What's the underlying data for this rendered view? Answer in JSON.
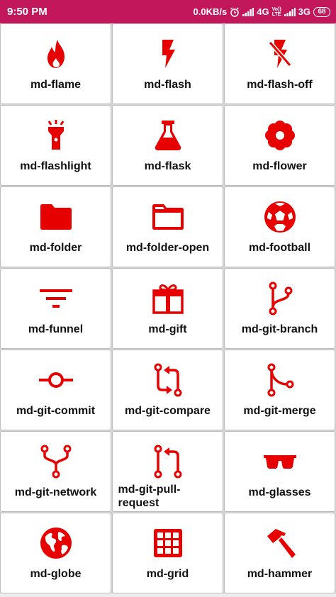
{
  "status_bar": {
    "time": "9:50 PM",
    "net_speed": "0.0KB/s",
    "network1": "4G",
    "volte_top": "Vo))",
    "volte_bottom": "LTE",
    "network2": "3G",
    "battery": "68"
  },
  "icon_color": "#e60000",
  "status_color": "#c2185b",
  "icons": [
    {
      "label": "md-flame",
      "icon": "flame-icon"
    },
    {
      "label": "md-flash",
      "icon": "flash-icon"
    },
    {
      "label": "md-flash-off",
      "icon": "flash-off-icon"
    },
    {
      "label": "md-flashlight",
      "icon": "flashlight-icon"
    },
    {
      "label": "md-flask",
      "icon": "flask-icon"
    },
    {
      "label": "md-flower",
      "icon": "flower-icon"
    },
    {
      "label": "md-folder",
      "icon": "folder-icon"
    },
    {
      "label": "md-folder-open",
      "icon": "folder-open-icon"
    },
    {
      "label": "md-football",
      "icon": "football-icon"
    },
    {
      "label": "md-funnel",
      "icon": "funnel-icon"
    },
    {
      "label": "md-gift",
      "icon": "gift-icon"
    },
    {
      "label": "md-git-branch",
      "icon": "git-branch-icon"
    },
    {
      "label": "md-git-commit",
      "icon": "git-commit-icon"
    },
    {
      "label": "md-git-compare",
      "icon": "git-compare-icon"
    },
    {
      "label": "md-git-merge",
      "icon": "git-merge-icon"
    },
    {
      "label": "md-git-network",
      "icon": "git-network-icon"
    },
    {
      "label": "md-git-pull-request",
      "icon": "git-pull-request-icon"
    },
    {
      "label": "md-glasses",
      "icon": "glasses-icon"
    },
    {
      "label": "md-globe",
      "icon": "globe-icon"
    },
    {
      "label": "md-grid",
      "icon": "grid-icon"
    },
    {
      "label": "md-hammer",
      "icon": "hammer-icon"
    }
  ]
}
